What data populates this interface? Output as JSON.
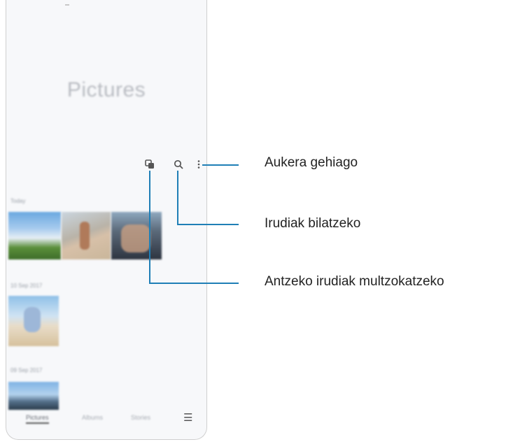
{
  "app": {
    "title": "Pictures",
    "sections": [
      {
        "label": "Today"
      },
      {
        "label": "10 Sep 2017"
      },
      {
        "label": "09 Sep 2017"
      }
    ]
  },
  "toolbar": {
    "icons": [
      "group-similar-icon",
      "search-icon",
      "more-options-icon"
    ]
  },
  "bottom_nav": {
    "items": [
      "Pictures",
      "Albums",
      "Stories"
    ],
    "active": "Pictures"
  },
  "callouts": {
    "more_options": "Aukera gehiago",
    "search": "Irudiak bilatzeko",
    "group_similar": "Antzeko irudiak multzokatzeko"
  },
  "colors": {
    "callout_line": "#1f7fb6"
  }
}
